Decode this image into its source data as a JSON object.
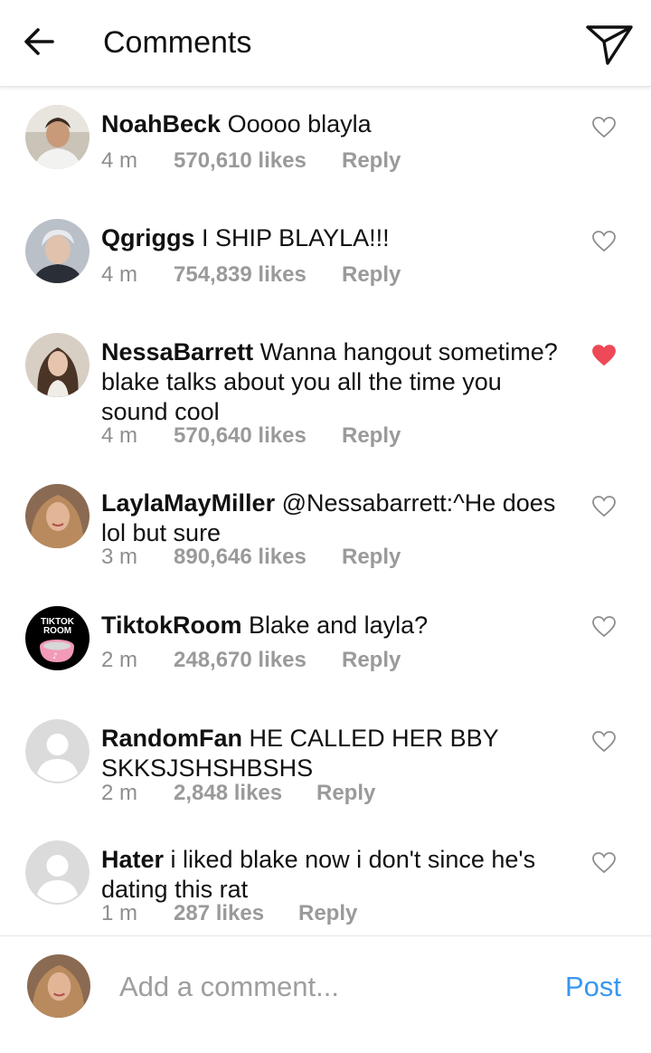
{
  "header": {
    "title": "Comments",
    "back_icon": "arrow-left-icon",
    "send_icon": "paper-plane-icon"
  },
  "comments": [
    {
      "user": "NoahBeck",
      "text": "Ooooo blayla",
      "time": "4 m",
      "likes": "570,610 likes",
      "reply": "Reply",
      "liked": false
    },
    {
      "user": "Qgriggs",
      "text": "I SHIP BLAYLA!!!",
      "time": "4 m",
      "likes": "754,839 likes",
      "reply": "Reply",
      "liked": false
    },
    {
      "user": "NessaBarrett",
      "text": "Wanna hangout sometime? blake talks about you all the time you sound cool",
      "time": "4 m",
      "likes": "570,640 likes",
      "reply": "Reply",
      "liked": true
    },
    {
      "user": "LaylaMayMiller",
      "text": "@Nessabarrett:^He does lol but sure",
      "time": "3 m",
      "likes": "890,646 likes",
      "reply": "Reply",
      "liked": false
    },
    {
      "user": "TiktokRoom",
      "text": "Blake and layla?",
      "time": "2 m",
      "likes": "248,670 likes",
      "reply": "Reply",
      "liked": false,
      "avatar_text": [
        "TIKTOK",
        "ROOM"
      ]
    },
    {
      "user": "RandomFan",
      "text": "HE CALLED HER BBY SKKSJSHSHBSHS",
      "time": "2 m",
      "likes": "2,848 likes",
      "reply": "Reply",
      "liked": false
    },
    {
      "user": "Hater",
      "text": "i liked blake now i don't since he's dating this rat",
      "time": "1 m",
      "likes": "287 likes",
      "reply": "Reply",
      "liked": false
    }
  ],
  "footer": {
    "placeholder": "Add a comment...",
    "post_label": "Post"
  },
  "colors": {
    "liked_heart": "#ed4956",
    "link_blue": "#3897f0",
    "meta_gray": "#8e8e8e"
  }
}
